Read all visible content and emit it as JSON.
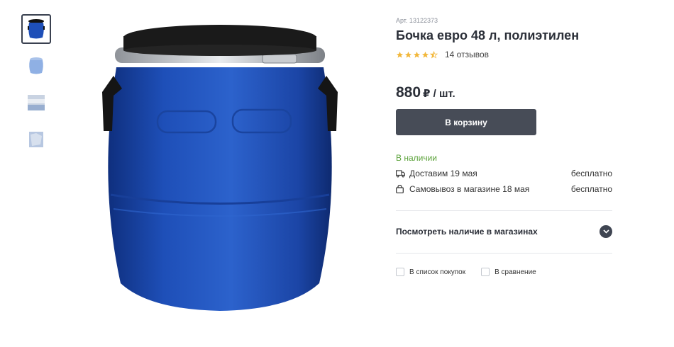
{
  "gallery": {
    "thumbnails": [
      {
        "name": "barrel-front",
        "active": true
      },
      {
        "name": "barrel-side",
        "active": false
      },
      {
        "name": "barrel-top",
        "active": false
      },
      {
        "name": "barrel-detail",
        "active": false
      }
    ]
  },
  "product": {
    "sku": "Арт. 13122373",
    "title": "Бочка евро 48 л, полиэтилен",
    "rating": 4.5,
    "reviews": "14 отзывов",
    "price": "880",
    "price_unit": "₽ / шт.",
    "cart_button": "В корзину",
    "stock_status": "В наличии"
  },
  "delivery": [
    {
      "icon": "truck-icon",
      "label": "Доставим 19 мая",
      "cost": "бесплатно"
    },
    {
      "icon": "bag-icon",
      "label": "Самовывоз в магазине 18 мая",
      "cost": "бесплатно"
    }
  ],
  "stores": {
    "label": "Посмотреть наличие в магазинах"
  },
  "actions": {
    "shopping_list": "В список покупок",
    "compare": "В сравнение"
  },
  "colors": {
    "accent_dark": "#474c57",
    "in_stock": "#5ba23a",
    "star": "#f2b73a",
    "barrel_blue": "#1e4fb8"
  }
}
